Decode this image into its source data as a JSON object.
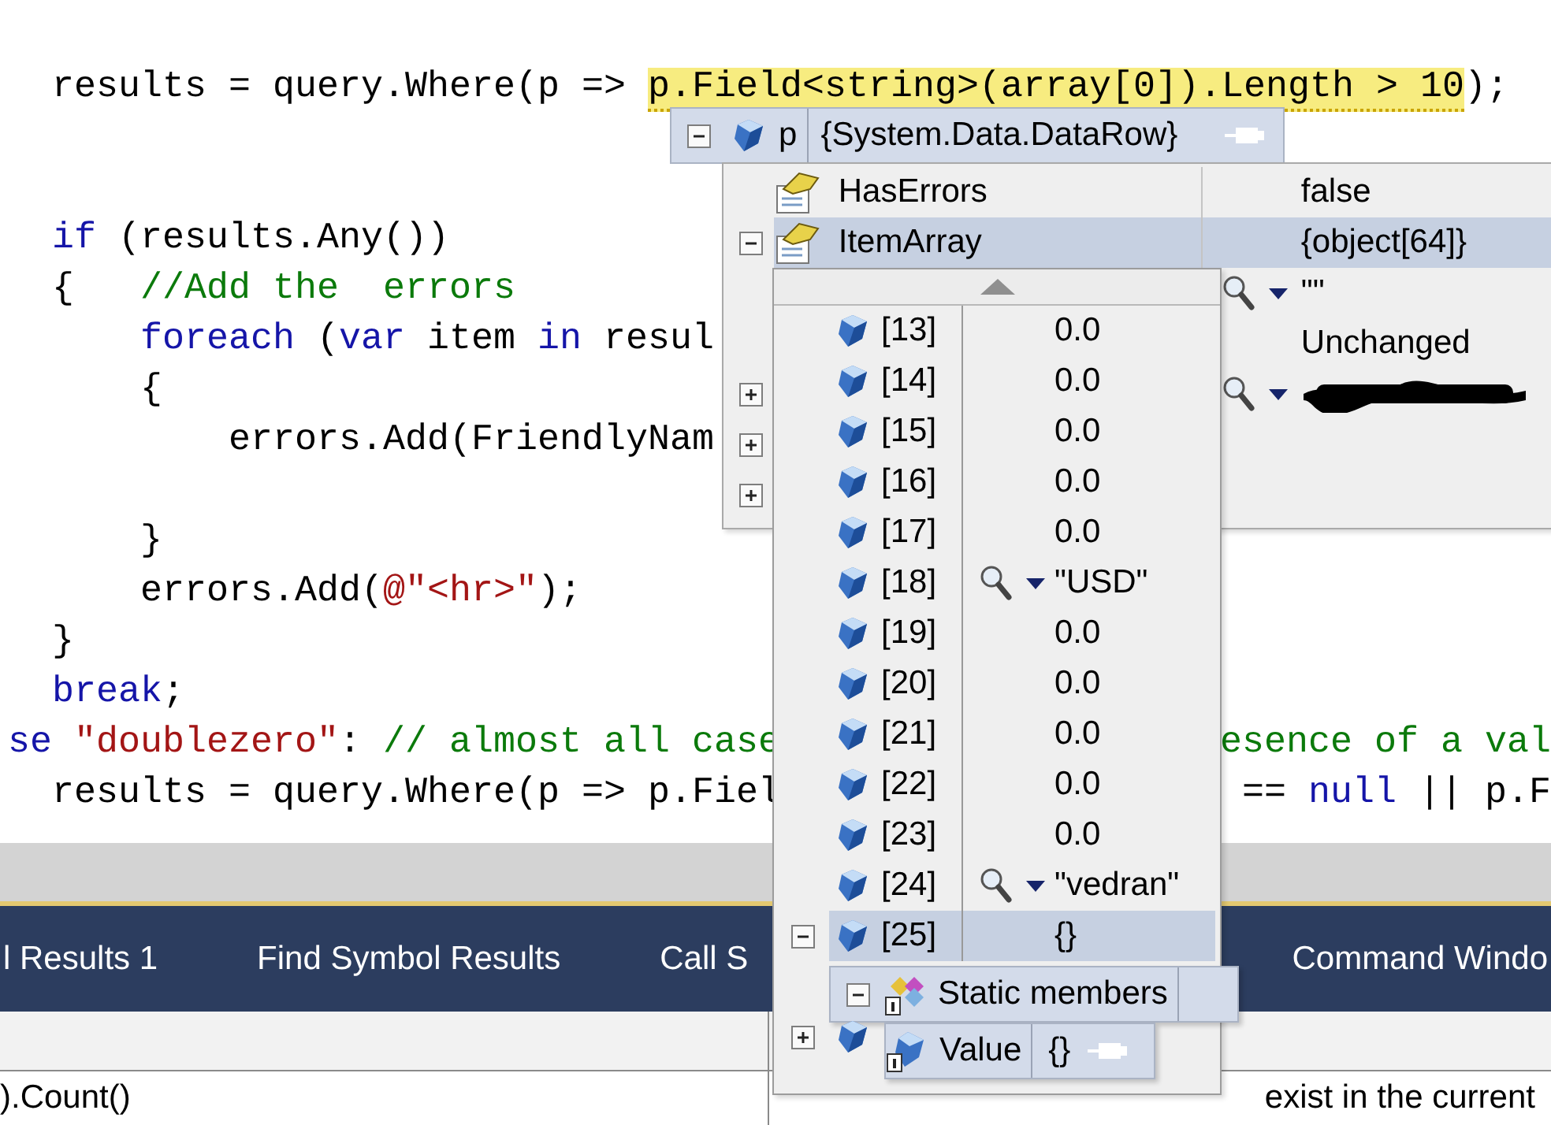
{
  "editor": {
    "lines": [
      {
        "kind": "code",
        "tokens": [
          {
            "kind": "plain",
            "text": "  results = query.Where(p => "
          },
          {
            "kind": "highlight",
            "text": "p.Field<string>(array[0]).Length > 10"
          },
          {
            "kind": "plain",
            "text": ");"
          }
        ]
      },
      {
        "kind": "blank"
      },
      {
        "kind": "blank"
      },
      {
        "kind": "code",
        "tokens": [
          {
            "kind": "keyword",
            "text": "  if"
          },
          {
            "kind": "plain",
            "text": " (results.Any())"
          }
        ]
      },
      {
        "kind": "code",
        "tokens": [
          {
            "kind": "plain",
            "text": "  {   "
          },
          {
            "kind": "comment",
            "text": "//Add the  errors"
          }
        ]
      },
      {
        "kind": "code",
        "tokens": [
          {
            "kind": "keyword",
            "text": "      foreach"
          },
          {
            "kind": "plain",
            "text": " ("
          },
          {
            "kind": "keyword",
            "text": "var"
          },
          {
            "kind": "plain",
            "text": " item "
          },
          {
            "kind": "keyword",
            "text": "in"
          },
          {
            "kind": "plain",
            "text": " resul"
          }
        ]
      },
      {
        "kind": "code",
        "tokens": [
          {
            "kind": "plain",
            "text": "      {"
          }
        ]
      },
      {
        "kind": "code",
        "tokens": [
          {
            "kind": "plain",
            "text": "          errors.Add(FriendlyNam"
          }
        ]
      },
      {
        "kind": "blank"
      },
      {
        "kind": "code",
        "tokens": [
          {
            "kind": "plain",
            "text": "      }"
          }
        ]
      },
      {
        "kind": "code",
        "tokens": [
          {
            "kind": "plain",
            "text": "      errors.Add("
          },
          {
            "kind": "string",
            "text": "@\"<hr>\""
          },
          {
            "kind": "plain",
            "text": ");"
          }
        ]
      },
      {
        "kind": "code",
        "tokens": [
          {
            "kind": "plain",
            "text": "  }"
          }
        ]
      },
      {
        "kind": "code",
        "tokens": [
          {
            "kind": "keyword",
            "text": "  break"
          },
          {
            "kind": "plain",
            "text": ";"
          }
        ]
      },
      {
        "kind": "code",
        "tokens": [
          {
            "kind": "keyword",
            "text": "se"
          },
          {
            "kind": "string",
            "text": " \"doublezero\""
          },
          {
            "kind": "plain",
            "text": ": "
          },
          {
            "kind": "comment",
            "text": "// almost all case"
          }
        ],
        "tail": [
          {
            "kind": "comment",
            "text": "esence of a val"
          }
        ]
      },
      {
        "kind": "code",
        "tokens": [
          {
            "kind": "plain",
            "text": "  results = query.Where(p => p.Fiel"
          }
        ],
        "tail": [
          {
            "kind": "plain",
            "text": "== "
          },
          {
            "kind": "keyword",
            "text": "null"
          },
          {
            "kind": "plain",
            "text": " || p.F"
          }
        ]
      }
    ]
  },
  "datatip": {
    "expandable": true,
    "expanded": true,
    "name": "p",
    "value": "{System.Data.DataRow}"
  },
  "members": [
    {
      "expandable": false,
      "name": "HasErrors",
      "value": "false",
      "visualizer": false,
      "selected": false
    },
    {
      "expandable": true,
      "expanded": true,
      "name": "ItemArray",
      "value": "{object[64]}",
      "visualizer": false,
      "selected": true
    },
    {
      "expandable": false,
      "value": "\"\"",
      "visualizer": true,
      "selected": false
    },
    {
      "expandable": false,
      "value": "Unchanged",
      "visualizer": false,
      "selected": false
    },
    {
      "expandable": true,
      "expanded": false,
      "visualizer": true,
      "redacted": true,
      "selected": false
    },
    {
      "expandable": true,
      "expanded": false,
      "visualizer": false,
      "selected": false
    },
    {
      "expandable": true,
      "expanded": false,
      "visualizer": false,
      "selected": false
    }
  ],
  "item_array": {
    "items": [
      {
        "index": "[13]",
        "value": "0.0",
        "visualizer": false,
        "expandable": false,
        "selected": false
      },
      {
        "index": "[14]",
        "value": "0.0",
        "visualizer": false,
        "expandable": false,
        "selected": false
      },
      {
        "index": "[15]",
        "value": "0.0",
        "visualizer": false,
        "expandable": false,
        "selected": false
      },
      {
        "index": "[16]",
        "value": "0.0",
        "visualizer": false,
        "expandable": false,
        "selected": false
      },
      {
        "index": "[17]",
        "value": "0.0",
        "visualizer": false,
        "expandable": false,
        "selected": false
      },
      {
        "index": "[18]",
        "value": "\"USD\"",
        "visualizer": true,
        "expandable": false,
        "selected": false
      },
      {
        "index": "[19]",
        "value": "0.0",
        "visualizer": false,
        "expandable": false,
        "selected": false
      },
      {
        "index": "[20]",
        "value": "0.0",
        "visualizer": false,
        "expandable": false,
        "selected": false
      },
      {
        "index": "[21]",
        "value": "0.0",
        "visualizer": false,
        "expandable": false,
        "selected": false
      },
      {
        "index": "[22]",
        "value": "0.0",
        "visualizer": false,
        "expandable": false,
        "selected": false
      },
      {
        "index": "[23]",
        "value": "0.0",
        "visualizer": false,
        "expandable": false,
        "selected": false
      },
      {
        "index": "[24]",
        "value": "\"vedran\"",
        "visualizer": true,
        "expandable": false,
        "selected": false
      },
      {
        "index": "[25]",
        "value": "{}",
        "visualizer": false,
        "expandable": true,
        "expanded": true,
        "selected": true
      }
    ],
    "static_members": {
      "label": "Static members",
      "expandable": true,
      "expanded": true
    },
    "child_row": {
      "expandable": true,
      "expanded": false
    },
    "value_tip": {
      "name": "Value",
      "value": "{}"
    }
  },
  "tool_tabs": [
    "l Results 1",
    "Find Symbol Results",
    "Call S",
    "Command Windo"
  ],
  "output": {
    "left": ").Count()",
    "right": "exist in the current"
  }
}
